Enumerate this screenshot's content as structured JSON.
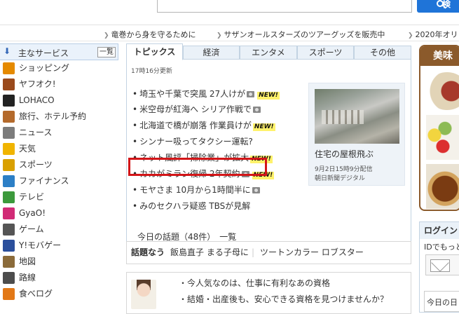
{
  "search": {
    "button_label": "検"
  },
  "ticker": [
    {
      "text": "竜巻から身を守るために"
    },
    {
      "text": "サザンオールスターズのツアーグッズを販売中"
    },
    {
      "text": "2020年オリ"
    }
  ],
  "sidebar": {
    "title": "主なサービス",
    "list_button": "一覧",
    "items": [
      {
        "label": "ショッピング",
        "icon": "cart-icon",
        "color": "#e58a00"
      },
      {
        "label": "ヤフオク!",
        "icon": "gavel-icon",
        "color": "#9a4a1c"
      },
      {
        "label": "LOHACO",
        "icon": "lohaco-logo-icon",
        "color": "#222222"
      },
      {
        "label": "旅行、ホテル予約",
        "icon": "suitcase-icon",
        "color": "#b46a2c"
      },
      {
        "label": "ニュース",
        "icon": "newspaper-icon",
        "color": "#7c7c7c"
      },
      {
        "label": "天気",
        "icon": "weather-icon",
        "color": "#f0b400"
      },
      {
        "label": "スポーツ",
        "icon": "trophy-icon",
        "color": "#d9a000"
      },
      {
        "label": "ファイナンス",
        "icon": "chart-icon",
        "color": "#2c7fc6"
      },
      {
        "label": "テレビ",
        "icon": "tv-icon",
        "color": "#3c9a3c"
      },
      {
        "label": "GyaO!",
        "icon": "gyao-icon",
        "color": "#d12b76"
      },
      {
        "label": "ゲーム",
        "icon": "gamepad-icon",
        "color": "#555555"
      },
      {
        "label": "Y!モバゲー",
        "icon": "mobage-icon",
        "color": "#2b4f9c"
      },
      {
        "label": "地図",
        "icon": "map-icon",
        "color": "#8b6b3a"
      },
      {
        "label": "路線",
        "icon": "train-icon",
        "color": "#4d4d4d"
      },
      {
        "label": "食べログ",
        "icon": "tabelog-icon",
        "color": "#e27817"
      }
    ]
  },
  "tabs": [
    {
      "label": "トピックス",
      "active": true
    },
    {
      "label": "経済",
      "active": false
    },
    {
      "label": "エンタメ",
      "active": false
    },
    {
      "label": "スポーツ",
      "active": false
    },
    {
      "label": "その他",
      "active": false
    }
  ],
  "topics": {
    "updated": "17時16分更新",
    "items": [
      {
        "text": "埼玉や千葉で突風 27人けが",
        "camera": true,
        "new": true
      },
      {
        "text": "米空母が紅海へ シリア作戦で",
        "camera": true,
        "new": false
      },
      {
        "text": "北海道で橋が崩落 作業員けが",
        "camera": false,
        "new": true
      },
      {
        "text": "シンナー吸ってタクシー運転?",
        "camera": false,
        "new": false
      },
      {
        "text": "ネット風評「掃除業」が拡大",
        "camera": false,
        "new": true,
        "highlighted": true
      },
      {
        "text": "カカがミラン復帰 2年契約",
        "camera": true,
        "new": true
      },
      {
        "text": "モヤさま 10月から1時間半に",
        "camera": true,
        "new": false
      },
      {
        "text": "みのセクハラ疑惑 TBSが見解",
        "camera": false,
        "new": false
      }
    ],
    "new_badge": "NEW!",
    "today_link": "今日の話題（48件）　一覧"
  },
  "photo": {
    "caption": "住宅の屋根飛ぶ",
    "date": "9月2日15時9分配信",
    "source": "朝日新聞デジタル"
  },
  "wadai": {
    "heading": "話題なう",
    "item1": "飯島直子 まる子母に",
    "item2": "ツートンカラー ロブスター"
  },
  "bottom": {
    "line1": "今人気なのは、仕事に有利なあの資格",
    "line2": "結婚・出産後も、安心できる資格を見つけませんか？"
  },
  "promo": {
    "title": "美味"
  },
  "login": {
    "heading": "ログイン",
    "text": "IDでもっと",
    "text2": "今日の日"
  }
}
